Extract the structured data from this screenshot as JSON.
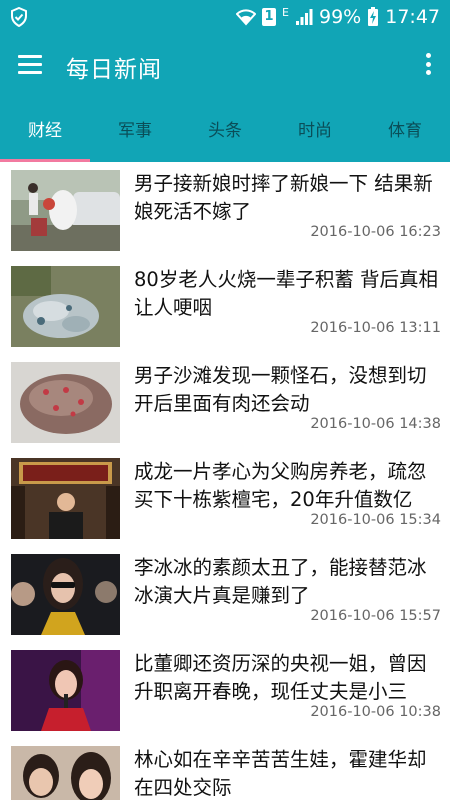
{
  "status": {
    "battery": "99%",
    "time": "17:47",
    "sim": "1",
    "network": "E"
  },
  "app": {
    "title": "每日新闻"
  },
  "tabs": [
    "财经",
    "军事",
    "头条",
    "时尚",
    "体育"
  ],
  "colors": {
    "primary": "#11a5b6",
    "indicator": "#f27aa0"
  },
  "news": [
    {
      "title": "男子接新娘时摔了新娘一下 结果新娘死活不嫁了",
      "time": "2016-10-06 16:23"
    },
    {
      "title": "80岁老人火烧一辈子积蓄 背后真相让人哽咽",
      "time": "2016-10-06 13:11"
    },
    {
      "title": "男子沙滩发现一颗怪石，没想到切开后里面有肉还会动",
      "time": "2016-10-06 14:38"
    },
    {
      "title": "成龙一片孝心为父购房养老，疏忽买下十栋紫檀宅，20年升值数亿",
      "time": "2016-10-06 15:34"
    },
    {
      "title": "李冰冰的素颜太丑了，能接替范冰冰演大片真是赚到了",
      "time": "2016-10-06 15:57"
    },
    {
      "title": "比董卿还资历深的央视一姐，曾因升职离开春晚，现任丈夫是小三",
      "time": "2016-10-06 10:38"
    },
    {
      "title": "林心如在辛辛苦苦生娃，霍建华却在四处交际",
      "time": ""
    }
  ]
}
